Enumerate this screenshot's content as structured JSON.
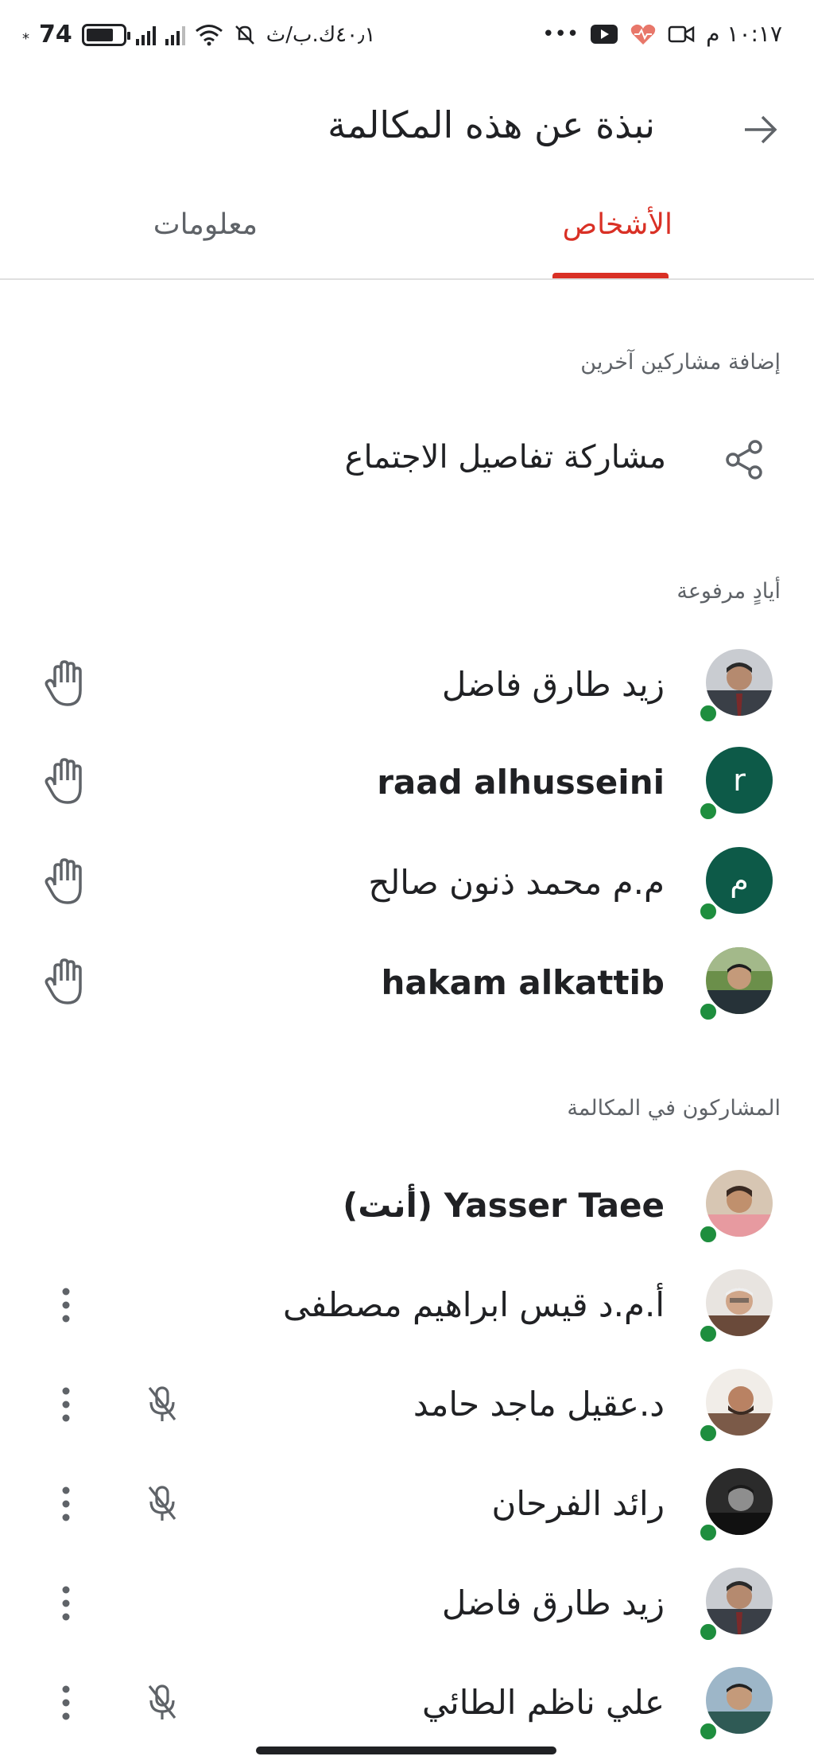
{
  "status_bar": {
    "battery_percent": "74",
    "network_speed": "٤٠٫١ك.ب/ث",
    "time": "١٠:١٧ م",
    "overflow": "•••",
    "battery_level": 0.74
  },
  "header": {
    "title": "نبذة عن هذه المكالمة"
  },
  "tabs": [
    {
      "label": "الأشخاص",
      "active": true
    },
    {
      "label": "معلومات",
      "active": false
    }
  ],
  "add_section": {
    "label": "إضافة مشاركين آخرين",
    "share_label": "مشاركة تفاصيل الاجتماع"
  },
  "raised_hands": {
    "label": "أيادٍ مرفوعة",
    "people": [
      {
        "name": "زيد طارق فاضل",
        "avatar": "photo"
      },
      {
        "name": "raad alhusseini",
        "avatar": "letter",
        "initial": "r"
      },
      {
        "name": "م.م محمد ذنون صالح",
        "avatar": "letter",
        "initial": "م"
      },
      {
        "name": "hakam alkattib",
        "avatar": "photo"
      }
    ]
  },
  "in_call": {
    "label": "المشاركون في المكالمة",
    "people": [
      {
        "name": "Yasser Taee (أنت)",
        "muted": false,
        "menu": false
      },
      {
        "name": "أ.م.د قيس ابراهيم مصطفى",
        "muted": false,
        "menu": true
      },
      {
        "name": "د.عقيل ماجد حامد",
        "muted": true,
        "menu": true
      },
      {
        "name": "رائد الفرحان",
        "muted": true,
        "menu": true
      },
      {
        "name": "زيد طارق فاضل",
        "muted": false,
        "menu": true
      },
      {
        "name": "علي ناظم الطائي",
        "muted": true,
        "menu": true
      }
    ]
  },
  "colors": {
    "accent": "#d93025",
    "presence": "#1e8e3e",
    "avatar_letter_bg": "#0d5a48"
  }
}
